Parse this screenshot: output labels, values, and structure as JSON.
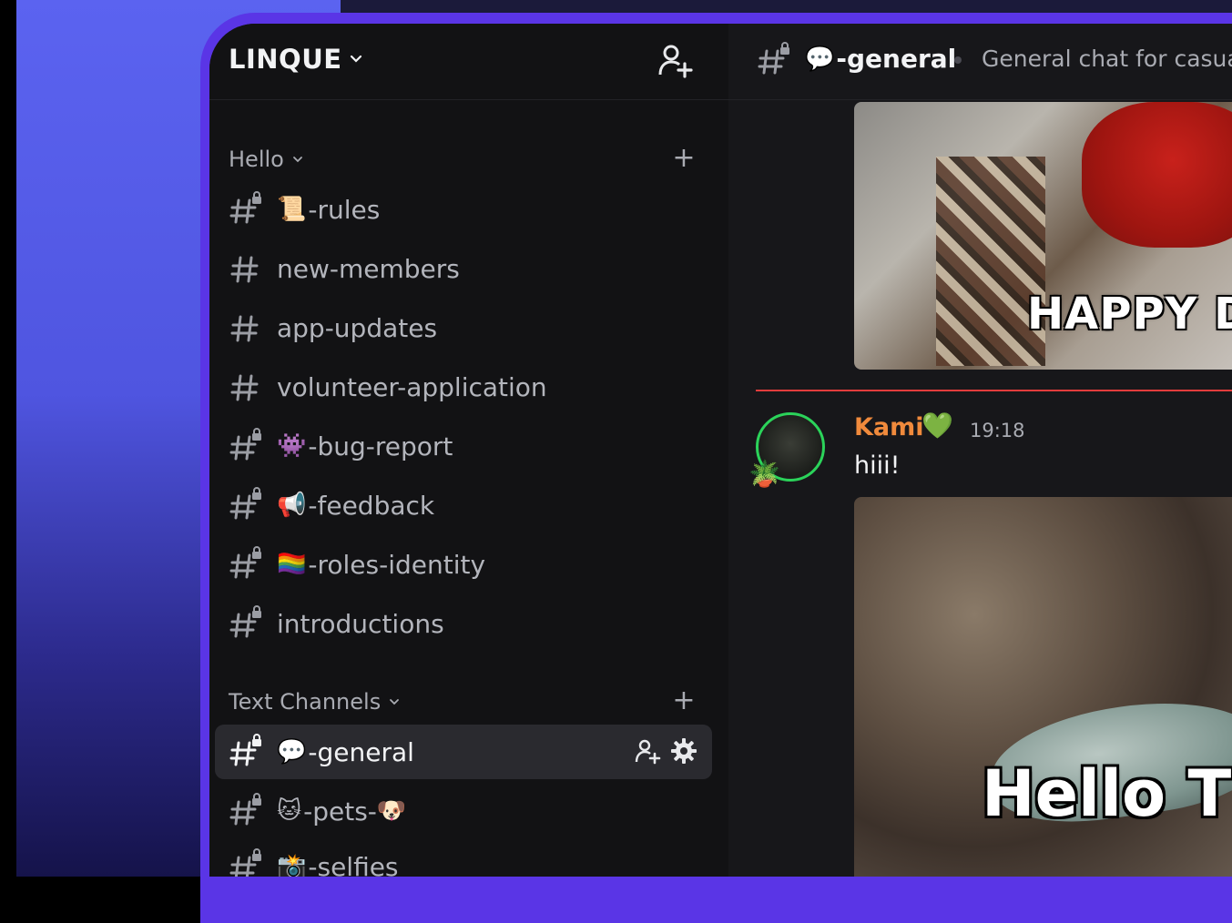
{
  "server": {
    "name": "LINQUE"
  },
  "sidebar": {
    "categories": [
      {
        "name": "Hello",
        "channels": [
          {
            "label": "-rules",
            "emoji": "📜",
            "locked": true
          },
          {
            "label": "new-members",
            "emoji": "",
            "locked": false
          },
          {
            "label": "app-updates",
            "emoji": "",
            "locked": false
          },
          {
            "label": "volunteer-application",
            "emoji": "",
            "locked": false
          },
          {
            "label": "-bug-report",
            "emoji": "👾",
            "locked": true
          },
          {
            "label": "-feedback",
            "emoji": "📢",
            "locked": true
          },
          {
            "label": "-roles-identity",
            "emoji": "🏳️‍🌈",
            "locked": true
          },
          {
            "label": "introductions",
            "emoji": "",
            "locked": true
          }
        ]
      },
      {
        "name": "Text Channels",
        "channels": [
          {
            "label": "-general",
            "emoji": "💬",
            "locked": true,
            "active": true
          },
          {
            "label": "-pets-",
            "emoji": "🐱",
            "emoji_after": "🐶",
            "locked": true
          },
          {
            "label": "-selfies",
            "emoji": "📸",
            "locked": true
          }
        ]
      }
    ]
  },
  "chat": {
    "channel_title": "-general",
    "channel_emoji": "💬",
    "topic": "General chat for casual",
    "gif1_caption": "HAPPY D",
    "message": {
      "author": "Kami",
      "author_badge": "💚",
      "time": "19:18",
      "text": "hiii!"
    },
    "gif2_caption": "Hello T"
  },
  "colors": {
    "accent_frame": "#5a35e6",
    "author_name": "#f08a3c",
    "new_divider": "#e23c3c",
    "avatar_ring": "#2bd35a"
  }
}
